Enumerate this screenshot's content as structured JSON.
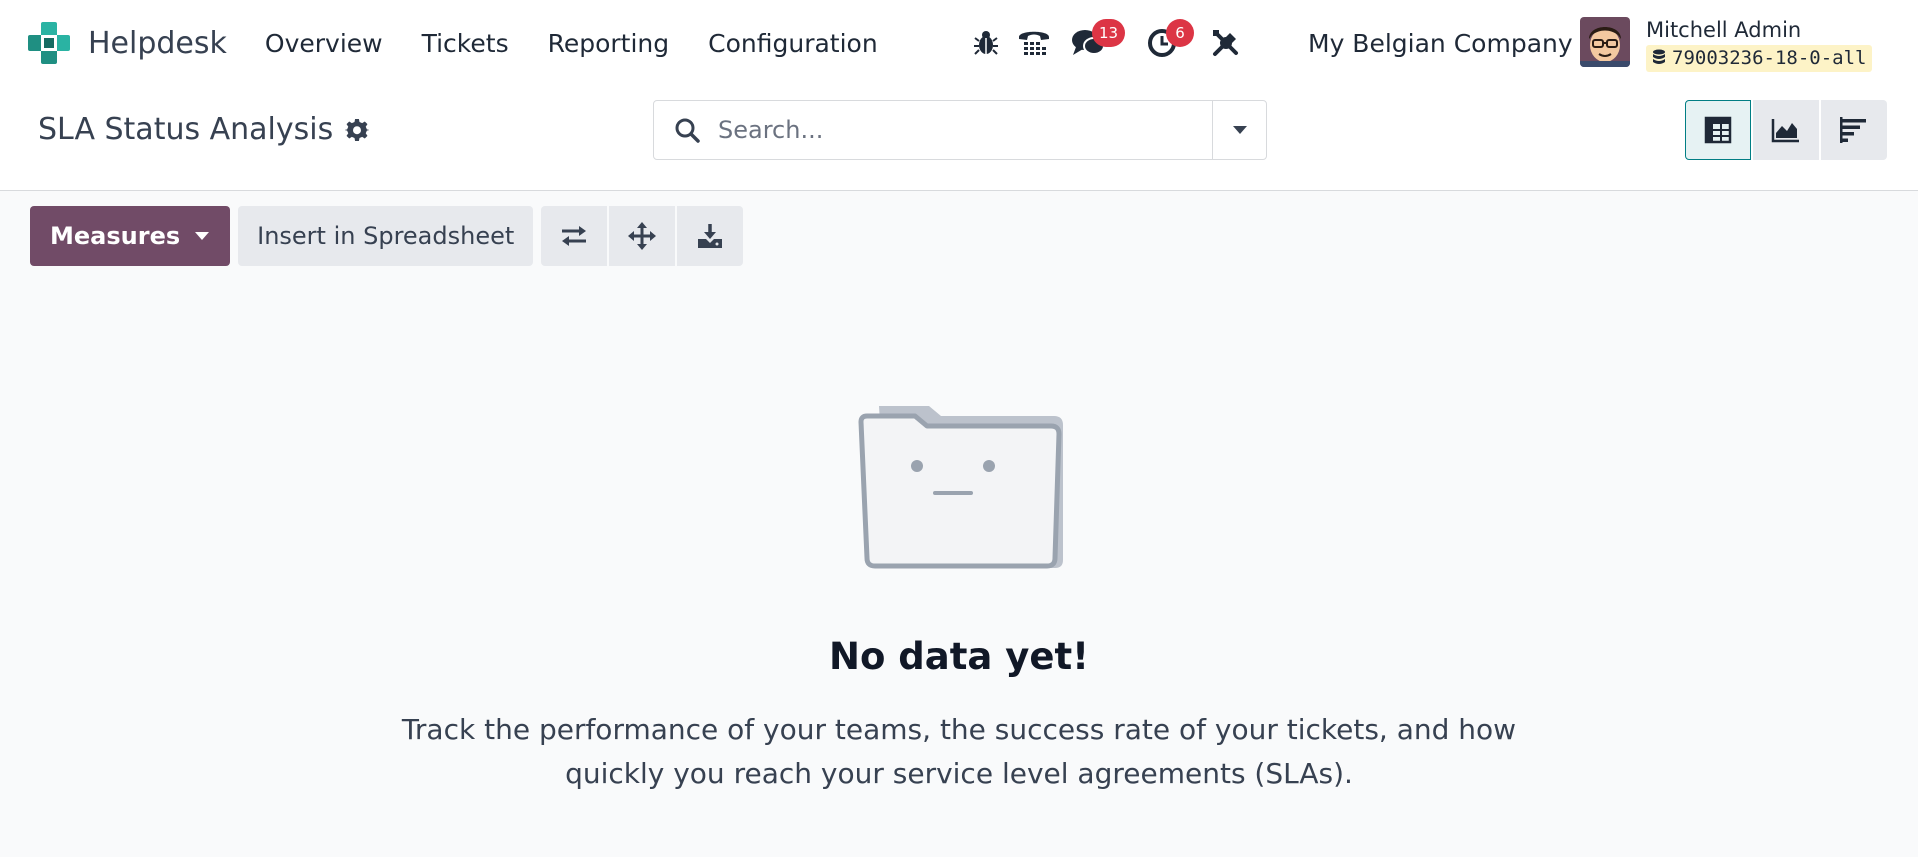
{
  "navbar": {
    "app_name": "Helpdesk",
    "menu": [
      {
        "label": "Overview"
      },
      {
        "label": "Tickets"
      },
      {
        "label": "Reporting"
      },
      {
        "label": "Configuration"
      }
    ],
    "messages_count": "13",
    "activities_count": "6",
    "company": "My Belgian Company",
    "user": {
      "name": "Mitchell Admin",
      "database": "79003236-18-0-all"
    }
  },
  "control_panel": {
    "title": "SLA Status Analysis",
    "search": {
      "placeholder": "Search..."
    }
  },
  "pivot": {
    "measures_label": "Measures",
    "insert_label": "Insert in Spreadsheet"
  },
  "empty_state": {
    "title": "No data yet!",
    "text": "Track the performance of your teams, the success rate of your tickets, and how quickly you reach your service level agreements (SLAs)."
  },
  "colors": {
    "brand_purple": "#714b67",
    "accent_teal": "#017e84",
    "badge_red": "#dc3545",
    "db_badge": "#fdf3c7",
    "background": "#f9fafb"
  },
  "icons": {
    "systray": [
      "bug-icon",
      "phone-icon",
      "chat-icon",
      "clock-icon",
      "tools-icon"
    ],
    "views": [
      "pivot-view-icon",
      "graph-view-icon",
      "list-view-icon"
    ],
    "pivot_actions": [
      "flip-axis-icon",
      "expand-all-icon",
      "download-icon"
    ]
  }
}
